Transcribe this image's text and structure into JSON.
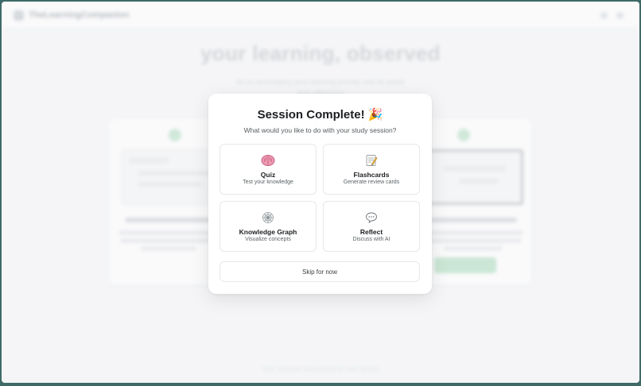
{
  "app": {
    "brand_name": "TheLearningCompanion",
    "hero_title": "your learning, observed",
    "hero_subtitle": [
      "let us accompany your learning journey with AI assist",
      "and reflections"
    ],
    "footer_text": "Your sessions stay private on your device"
  },
  "modal": {
    "title": "Session Complete! 🎉",
    "subtitle": "What would you like to do with your study session?",
    "options": [
      {
        "label": "Quiz",
        "description": "Test your knowledge",
        "icon": "brain-icon"
      },
      {
        "label": "Flashcards",
        "description": "Generate review cards",
        "icon": "memo-icon"
      },
      {
        "label": "Knowledge Graph",
        "description": "Visualize concepts",
        "icon": "graph-icon"
      },
      {
        "label": "Reflect",
        "description": "Discuss with AI",
        "icon": "speech-bubble-icon"
      }
    ],
    "skip_label": "Skip for now"
  },
  "colors": {
    "accent_green": "#bfe4cc",
    "desktop_background": "#3f6a67",
    "brain_pink": "#e88ea8"
  }
}
